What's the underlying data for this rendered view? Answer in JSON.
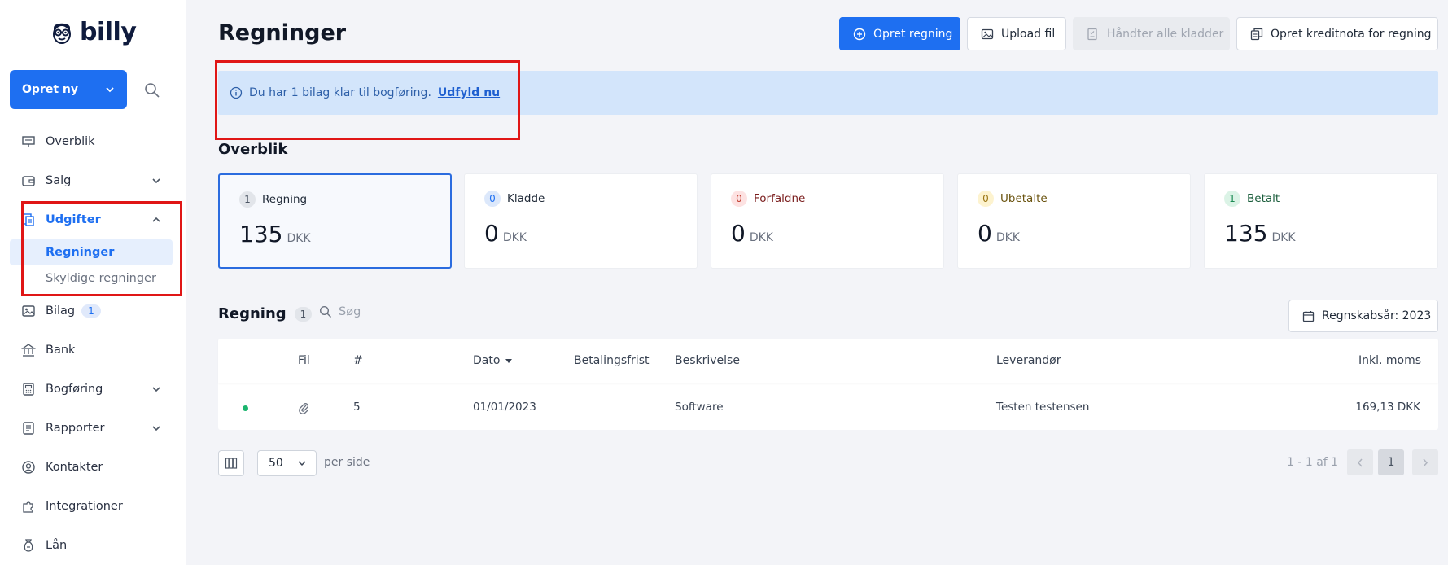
{
  "brand": {
    "name": "billy"
  },
  "sidebar": {
    "create_label": "Opret ny",
    "nav": [
      {
        "label": "Overblik",
        "icon": "presentation-icon"
      },
      {
        "label": "Salg",
        "icon": "wallet-icon",
        "expandable": true
      },
      {
        "label": "Udgifter",
        "icon": "receipt-icon",
        "expanded": true,
        "active": true
      },
      {
        "label": "Bilag",
        "icon": "image-icon",
        "badge": "1"
      },
      {
        "label": "Bank",
        "icon": "bank-icon"
      },
      {
        "label": "Bogføring",
        "icon": "calculator-icon",
        "expandable": true
      },
      {
        "label": "Rapporter",
        "icon": "report-icon",
        "expandable": true
      },
      {
        "label": "Kontakter",
        "icon": "user-circle-icon"
      },
      {
        "label": "Integrationer",
        "icon": "puzzle-icon"
      },
      {
        "label": "Lån",
        "icon": "money-bag-icon"
      }
    ],
    "sub_items": [
      {
        "label": "Regninger",
        "active": true
      },
      {
        "label": "Skyldige regninger"
      }
    ]
  },
  "header": {
    "title": "Regninger",
    "buttons": {
      "create": "Opret regning",
      "upload": "Upload fil",
      "handle_drafts": "Håndter alle kladder",
      "credit_note": "Opret kreditnota for regning"
    }
  },
  "banner": {
    "text": "Du har 1 bilag klar til bogføring.",
    "link": "Udfyld nu"
  },
  "overview": {
    "title": "Overblik",
    "cards": [
      {
        "label": "Regning",
        "count": "1",
        "amount": "135",
        "currency": "DKK",
        "badge_bg": "#e2e5ea",
        "badge_fg": "#4b5563",
        "label_color": "#1f2937"
      },
      {
        "label": "Kladde",
        "count": "0",
        "amount": "0",
        "currency": "DKK",
        "badge_bg": "#dce8fb",
        "badge_fg": "#1e6ff1",
        "label_color": "#1f2937"
      },
      {
        "label": "Forfaldne",
        "count": "0",
        "amount": "0",
        "currency": "DKK",
        "badge_bg": "#fde2e2",
        "badge_fg": "#c0392b",
        "label_color": "#7a1d1d"
      },
      {
        "label": "Ubetalte",
        "count": "0",
        "amount": "0",
        "currency": "DKK",
        "badge_bg": "#fdf3cf",
        "badge_fg": "#9a7412",
        "label_color": "#6b5410"
      },
      {
        "label": "Betalt",
        "count": "1",
        "amount": "135",
        "currency": "DKK",
        "badge_bg": "#dbf3e6",
        "badge_fg": "#1b8a53",
        "label_color": "#1b5e3c"
      }
    ]
  },
  "list": {
    "title": "Regning",
    "count": "1",
    "search_placeholder": "Søg",
    "fiscal_year": "Regnskabsår: 2023"
  },
  "table": {
    "columns": [
      "Fil",
      "#",
      "Dato",
      "Betalingsfrist",
      "Beskrivelse",
      "Leverandør",
      "Inkl. moms"
    ],
    "rows": [
      {
        "number": "5",
        "date": "01/01/2023",
        "due": "",
        "description": "Software",
        "supplier": "Testen testensen",
        "total": "169,13 DKK"
      }
    ]
  },
  "pagination": {
    "per_page": "50",
    "per_page_label": "per side",
    "range": "1 - 1 af 1",
    "current_page": "1"
  },
  "colors": {
    "accent": "#1e6ff1",
    "annotation": "#e01616",
    "banner_bg": "#d3e5fb"
  }
}
